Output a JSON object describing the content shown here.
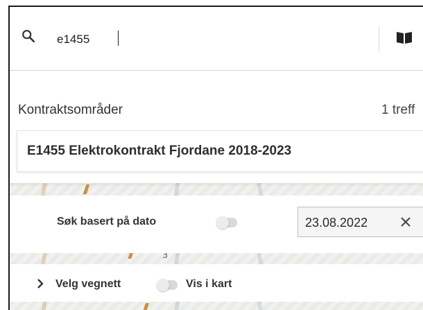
{
  "search": {
    "value": "e1455",
    "icon": "search-icon",
    "map_icon": "book-open-icon"
  },
  "results": {
    "section_title": "Kontraktsområder",
    "hit_count": "1 treff",
    "items": [
      {
        "label": "E1455 Elektrokontrakt Fjordane 2018-2023"
      }
    ]
  },
  "date_filter": {
    "label": "Søk basert på dato",
    "toggle_on": false,
    "date_value": "23.08.2022",
    "clear_icon": "close-icon"
  },
  "network": {
    "expand_icon": "chevron-right-icon",
    "label": "Velg vegnett",
    "toggle_on": false,
    "map_label": "Vis i kart"
  },
  "map_backdrop": {
    "road_number": "3"
  },
  "colors": {
    "toggle_track": "#d9d9d9",
    "panel_bg": "#ffffff",
    "date_field_bg": "#f5f5f5",
    "map_road": "#c99142"
  }
}
